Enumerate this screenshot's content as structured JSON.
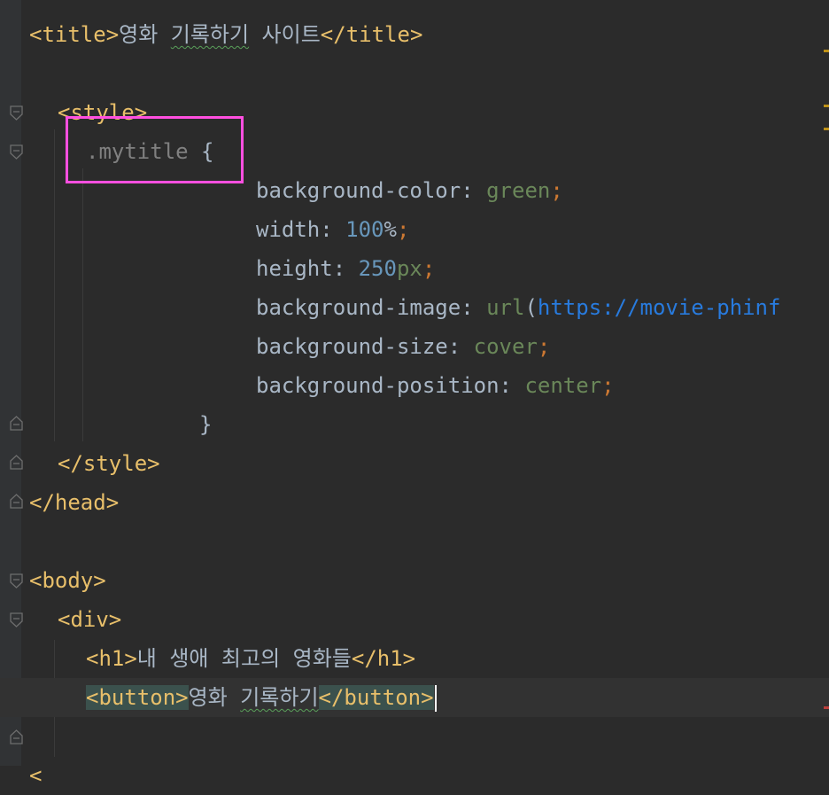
{
  "editor": {
    "lines": [
      {
        "id": "l1",
        "parts": [
          [
            "tag",
            "<title>"
          ],
          [
            "txt",
            "영화 "
          ],
          [
            "spell",
            "기록하기"
          ],
          [
            "txt",
            " 사이트"
          ],
          [
            "tag",
            "</title>"
          ]
        ]
      },
      {
        "id": "l2",
        "parts": []
      },
      {
        "id": "l3",
        "parts": [
          [
            "tag",
            "<style>"
          ]
        ]
      },
      {
        "id": "l4",
        "parts": [
          [
            "sel",
            ".mytitle "
          ],
          [
            "txt",
            "{"
          ]
        ]
      },
      {
        "id": "l5",
        "parts": [
          [
            "txt",
            "background-color: "
          ],
          [
            "str",
            "green"
          ],
          [
            "kw",
            ";"
          ]
        ]
      },
      {
        "id": "l6",
        "parts": [
          [
            "txt",
            "width: "
          ],
          [
            "num",
            "100"
          ],
          [
            "txt",
            "%"
          ],
          [
            "kw",
            ";"
          ]
        ]
      },
      {
        "id": "l7",
        "parts": [
          [
            "txt",
            "height: "
          ],
          [
            "num",
            "250"
          ],
          [
            "str",
            "px"
          ],
          [
            "kw",
            ";"
          ]
        ]
      },
      {
        "id": "l8",
        "parts": [
          [
            "txt",
            "background-image: "
          ],
          [
            "str",
            "url"
          ],
          [
            "txt",
            "("
          ],
          [
            "url",
            "https://movie-phinf"
          ]
        ]
      },
      {
        "id": "l9",
        "parts": [
          [
            "txt",
            "background-size: "
          ],
          [
            "str",
            "cover"
          ],
          [
            "kw",
            ";"
          ]
        ]
      },
      {
        "id": "l10",
        "parts": [
          [
            "txt",
            "background-position: "
          ],
          [
            "str",
            "center"
          ],
          [
            "kw",
            ";"
          ]
        ]
      },
      {
        "id": "l11",
        "parts": [
          [
            "txt",
            "}"
          ]
        ]
      },
      {
        "id": "l12",
        "parts": [
          [
            "tag",
            "</style>"
          ]
        ]
      },
      {
        "id": "l13",
        "parts": [
          [
            "tag",
            "</head>"
          ]
        ]
      },
      {
        "id": "l14",
        "parts": []
      },
      {
        "id": "l15",
        "parts": [
          [
            "tag",
            "<body>"
          ]
        ]
      },
      {
        "id": "l16",
        "parts": [
          [
            "tag",
            "<div>"
          ]
        ]
      },
      {
        "id": "l17",
        "parts": [
          [
            "tag",
            "<h1>"
          ],
          [
            "txt",
            "내 생애 최고의 영화들"
          ],
          [
            "tag",
            "</h1>"
          ]
        ]
      },
      {
        "id": "l18",
        "parts": [
          [
            "tagm",
            "<button>"
          ],
          [
            "txt",
            "영화 "
          ],
          [
            "spell",
            "기록하기"
          ],
          [
            "tagm",
            "</button>"
          ]
        ]
      },
      {
        "id": "l19",
        "parts": []
      },
      {
        "id": "l20",
        "parts": [
          [
            "tag",
            "<"
          ]
        ]
      }
    ]
  },
  "colors": {
    "background": "#2b2b2b",
    "tag": "#e8bf6a",
    "keyword": "#cc7832",
    "string": "#6a8759",
    "number": "#6897bb",
    "text": "#a9b7c6",
    "url": "#287bde",
    "highlight_box": "#ff4fe0"
  }
}
